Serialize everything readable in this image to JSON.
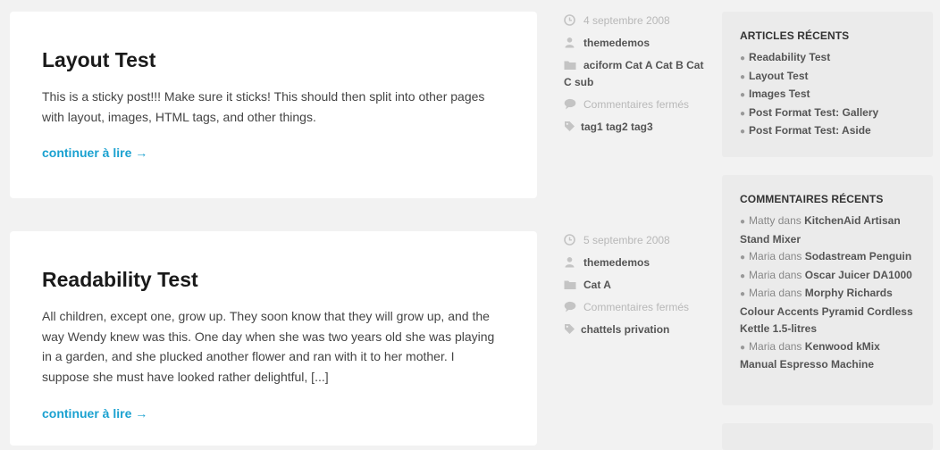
{
  "posts": [
    {
      "title": "Layout Test",
      "excerpt": "This is a sticky post!!! Make sure it sticks! This should then split into other pages with layout, images, HTML tags, and other things.",
      "more": "continuer à lire →",
      "meta": {
        "date": "4 septembre 2008",
        "author": "themedemos",
        "categories": "aciform Cat A Cat B Cat C sub",
        "comments": "Commentaires fermés",
        "tags": "tag1 tag2 tag3"
      }
    },
    {
      "title": "Readability Test",
      "excerpt": "All children, except one, grow up. They soon know that they will grow up, and the way Wendy knew was this. One day when she was two years old she was playing in a garden, and she plucked another flower and ran with it to her mother. I suppose she must have looked rather delightful, [...]",
      "more": "continuer à lire →",
      "meta": {
        "date": "5 septembre 2008",
        "author": "themedemos",
        "categories": "Cat A",
        "comments": "Commentaires fermés",
        "tags": "chattels privation"
      }
    }
  ],
  "sidebar": {
    "recent_posts": {
      "title": "ARTICLES RÉCENTS",
      "items": [
        "Readability Test",
        "Layout Test",
        "Images Test",
        "Post Format Test: Gallery",
        "Post Format Test: Aside"
      ]
    },
    "recent_comments": {
      "title": "COMMENTAIRES RÉCENTS",
      "items": [
        {
          "author": "Matty",
          "sep": "dans",
          "post": "KitchenAid Artisan Stand Mixer"
        },
        {
          "author": "Maria",
          "sep": "dans",
          "post": "Sodastream Penguin"
        },
        {
          "author": "Maria",
          "sep": "dans",
          "post": "Oscar Juicer DA1000"
        },
        {
          "author": "Maria",
          "sep": "dans",
          "post": "Morphy Richards Colour Accents Pyramid Cordless Kettle 1.5-litres"
        },
        {
          "author": "Maria",
          "sep": "dans",
          "post": "Kenwood kMix Manual Espresso Machine"
        }
      ]
    }
  },
  "colors": {
    "accent": "#1aa1d0",
    "background": "#f2f2f2",
    "card": "#ffffff",
    "widget": "#ebebeb",
    "muted": "#b8b8b8"
  }
}
